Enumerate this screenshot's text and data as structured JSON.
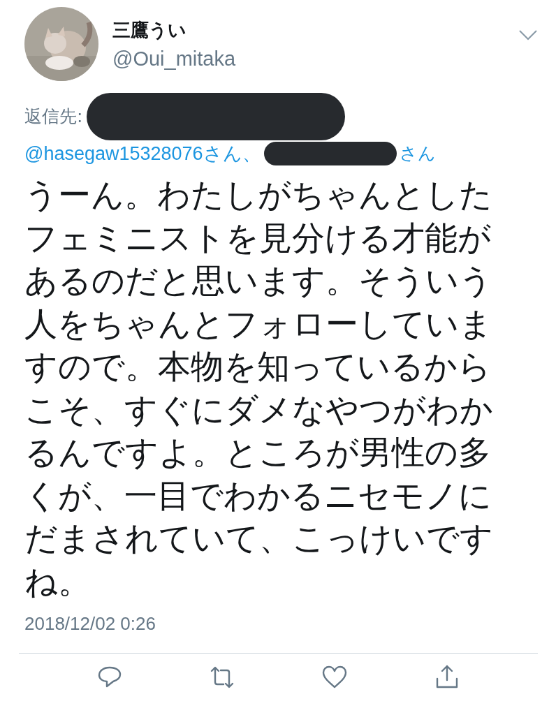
{
  "tweet": {
    "display_name": "三鷹うい",
    "handle": "@Oui_mitaka",
    "reply_label": "返信先:",
    "reply_to": [
      {
        "kind": "redacted"
      },
      {
        "kind": "mention",
        "text": "@hasegaw15328076さん、"
      },
      {
        "kind": "redacted"
      },
      {
        "kind": "suffix",
        "text": "さん"
      }
    ],
    "body": "うーん。わたしがちゃんとしたフェミニストを見分ける才能があるのだと思います。そういう人をちゃんとフォローしていますので。本物を知っているからこそ、すぐにダメなやつがわかるんですよ。ところが男性の多くが、一目でわかるニセモノにだまされていて、こっけいですね。",
    "timestamp": "2018/12/02 0:26",
    "actions": [
      {
        "kind": "reply"
      },
      {
        "kind": "retweet"
      },
      {
        "kind": "like"
      },
      {
        "kind": "share"
      }
    ]
  }
}
